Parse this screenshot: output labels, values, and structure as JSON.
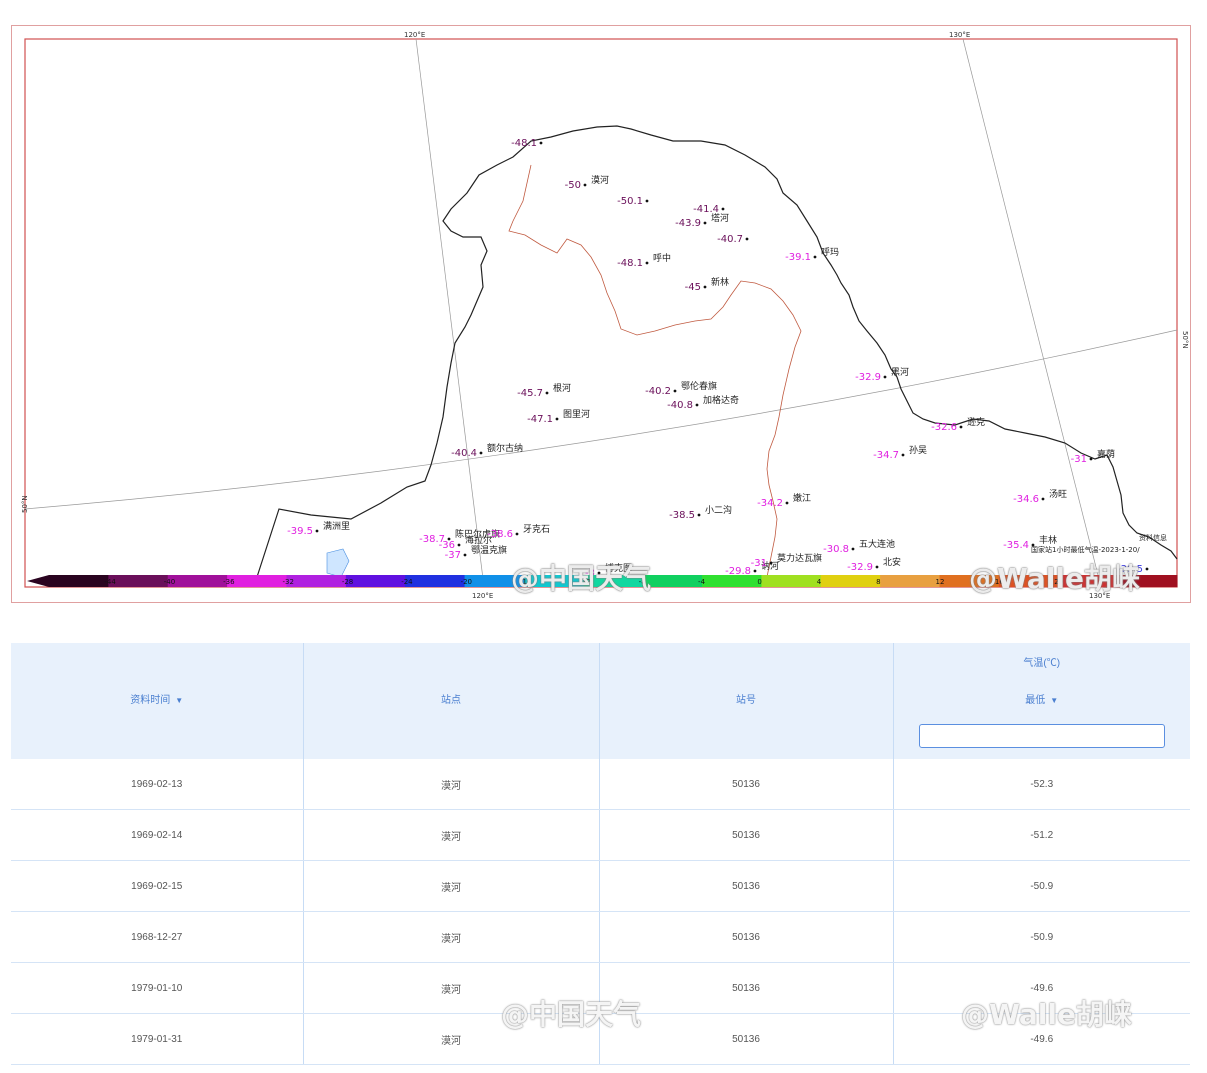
{
  "map": {
    "graticule": {
      "lon_top_left": "120°E",
      "lon_top_right": "130°E",
      "lon_bottom_left": "120°E",
      "lon_bottom_right": "130°E",
      "lat_left": "50°N",
      "lat_right": "50°N"
    },
    "stations": [
      {
        "name": "",
        "value": "-48.1",
        "color": "#6a0f5a"
      },
      {
        "name": "漠河",
        "value": "-50",
        "color": "#6a0f5a"
      },
      {
        "name": "",
        "value": "-50.1",
        "color": "#6a0f5a"
      },
      {
        "name": "",
        "value": "-41.4",
        "color": "#6a0f5a"
      },
      {
        "name": "塔河",
        "value": "-43.9",
        "color": "#6a0f5a"
      },
      {
        "name": "",
        "value": "-40.7",
        "color": "#6a0f5a"
      },
      {
        "name": "呼玛",
        "value": "-39.1",
        "color": "#e020e0"
      },
      {
        "name": "呼中",
        "value": "-48.1",
        "color": "#6a0f5a"
      },
      {
        "name": "新林",
        "value": "-45",
        "color": "#6a0f5a"
      },
      {
        "name": "根河",
        "value": "-45.7",
        "color": "#6a0f5a"
      },
      {
        "name": "图里河",
        "value": "-47.1",
        "color": "#6a0f5a"
      },
      {
        "name": "鄂伦春旗",
        "value": "-40.2",
        "color": "#6a0f5a"
      },
      {
        "name": "加格达奇",
        "value": "-40.8",
        "color": "#6a0f5a"
      },
      {
        "name": "额尔古纳",
        "value": "-40.4",
        "color": "#6a0f5a"
      },
      {
        "name": "黑河",
        "value": "-32.9",
        "color": "#e020e0"
      },
      {
        "name": "逊克",
        "value": "-32.6",
        "color": "#e020e0"
      },
      {
        "name": "孙吴",
        "value": "-34.7",
        "color": "#e020e0"
      },
      {
        "name": "嘉荫",
        "value": "-31",
        "color": "#e020e0"
      },
      {
        "name": "汤旺",
        "value": "-34.6",
        "color": "#e020e0"
      },
      {
        "name": "丰林",
        "value": "-35.4",
        "color": "#e020e0"
      },
      {
        "name": "满洲里",
        "value": "-39.5",
        "color": "#e020e0"
      },
      {
        "name": "陈巴尔虎旗",
        "value": "-38.7",
        "color": "#e020e0"
      },
      {
        "name": "牙克石",
        "value": "-38.6",
        "color": "#e020e0"
      },
      {
        "name": "海拉尔",
        "value": "-36",
        "color": "#e020e0"
      },
      {
        "name": "鄂温克旗",
        "value": "-37",
        "color": "#e020e0"
      },
      {
        "name": "小二沟",
        "value": "-38.5",
        "color": "#6a0f5a"
      },
      {
        "name": "嫩江",
        "value": "-34.2",
        "color": "#e020e0"
      },
      {
        "name": "五大连池",
        "value": "-30.8",
        "color": "#e020e0"
      },
      {
        "name": "北安",
        "value": "-32.9",
        "color": "#e020e0"
      },
      {
        "name": "讷河",
        "value": "-29.8",
        "color": "#e020e0"
      },
      {
        "name": "莫力达瓦旗",
        "value": "-31",
        "color": "#e020e0"
      },
      {
        "name": "博克图",
        "value": "-3",
        "color": "#e020e0"
      },
      {
        "name": "",
        "value": "-29.5",
        "color": "#3a3ae0"
      }
    ],
    "legend_ticks": [
      "-44",
      "-40",
      "-36",
      "-32",
      "-28",
      "-24",
      "-20",
      "-16",
      "-12",
      "-8",
      "-4",
      "0",
      "4",
      "8",
      "12",
      "16",
      "20",
      "24"
    ],
    "legend_colors": [
      "#2a0420",
      "#6a0f5a",
      "#a0109a",
      "#e020e0",
      "#b020e0",
      "#6010e0",
      "#2030e0",
      "#1090e8",
      "#10c8d0",
      "#10d8a0",
      "#10d060",
      "#30e030",
      "#a0e020",
      "#e0d010",
      "#e8a040",
      "#e07020",
      "#e05020",
      "#d03030",
      "#a01020"
    ],
    "source_label": "资料信息",
    "subtitle": "国家站1小时最低气温-2023-1-20/",
    "watermark_left": "@中国天气",
    "watermark_right": "@Walle胡崃"
  },
  "table": {
    "group_header": "气温(℃)",
    "columns": [
      "资料时间",
      "站点",
      "站号",
      "最低"
    ],
    "rows": [
      [
        "1969-02-13",
        "漠河",
        "50136",
        "-52.3"
      ],
      [
        "1969-02-14",
        "漠河",
        "50136",
        "-51.2"
      ],
      [
        "1969-02-15",
        "漠河",
        "50136",
        "-50.9"
      ],
      [
        "1968-12-27",
        "漠河",
        "50136",
        "-50.9"
      ],
      [
        "1979-01-10",
        "漠河",
        "50136",
        "-49.6"
      ],
      [
        "1979-01-31",
        "漠河",
        "50136",
        "-49.6"
      ]
    ],
    "filter_placeholder": ""
  }
}
